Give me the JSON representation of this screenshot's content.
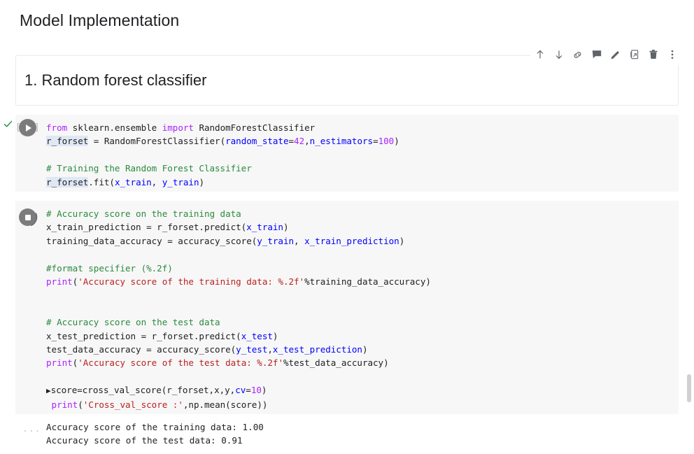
{
  "notebook": {
    "title": "Model Implementation"
  },
  "toolbar": {
    "buttons": [
      {
        "name": "move-cell-up-icon",
        "label": "Move cell up"
      },
      {
        "name": "move-cell-down-icon",
        "label": "Move cell down"
      },
      {
        "name": "link-to-cell-icon",
        "label": "Link to cell"
      },
      {
        "name": "add-comment-icon",
        "label": "Add comment"
      },
      {
        "name": "edit-icon",
        "label": "Edit"
      },
      {
        "name": "mirror-cell-in-tab-icon",
        "label": "Mirror cell in tab"
      },
      {
        "name": "delete-cell-icon",
        "label": "Delete cell"
      },
      {
        "name": "more-options-icon",
        "label": "More cell actions"
      }
    ]
  },
  "markdown_cell": {
    "heading": "1. Random forest classifier"
  },
  "cells": [
    {
      "id": "cell-1",
      "status": "executed",
      "execution_indicator": "[ ]",
      "run_button": "run-icon",
      "check_mark": "✓",
      "lines": [
        "from sklearn.ensemble import RandomForestClassifier",
        "r_forset = RandomForestClassifier(random_state=42,n_estimators=100)",
        "",
        "# Training the Random Forest Classifier",
        "r_forset.fit(x_train, y_train)"
      ]
    },
    {
      "id": "cell-2",
      "status": "running",
      "run_button": "stop-icon",
      "lines": [
        "# Accuracy score on the training data",
        "x_train_prediction = r_forset.predict(x_train)",
        "training_data_accuracy = accuracy_score(y_train, x_train_prediction)",
        "",
        "#format specifier (%.2f)",
        "print('Accuracy score of the training data: %.2f'%training_data_accuracy)",
        "",
        "",
        "# Accuracy score on the test data",
        "x_test_prediction = r_forset.predict(x_test)",
        "test_data_accuracy = accuracy_score(y_test,x_test_prediction)",
        "print('Accuracy score of the test data: %.2f'%test_data_accuracy)",
        "",
        "score=cross_val_score(r_forset,x,y,cv=10)",
        "print('Cross_val_score :',np.mean(score))"
      ]
    }
  ],
  "output": {
    "gutter": "...",
    "lines": [
      "Accuracy score of the training data: 1.00",
      "Accuracy score of the test data: 0.91"
    ]
  },
  "colors": {
    "keyword": "#aa22ff",
    "comment": "#2b8a3e",
    "string": "#ba2121",
    "number": "#aa22ff",
    "argument": "#0000ff",
    "cell_background": "#f7f7f7",
    "page_background": "#ffffff",
    "selection_highlight": "#e0e8f5",
    "check_green": "#1e8e3e"
  }
}
